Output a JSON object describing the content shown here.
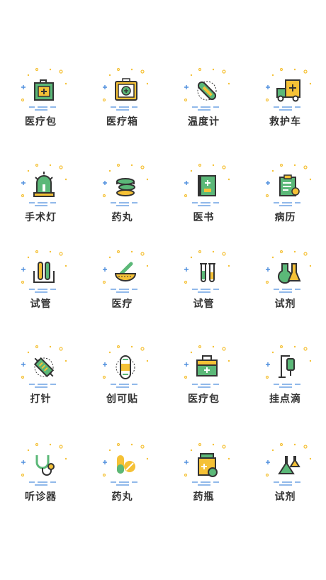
{
  "colors": {
    "green": "#5bb878",
    "dark": "#333333",
    "yellow": "#f5c136",
    "blue": "#4f8fde",
    "bg": "#ffffff"
  },
  "icons": [
    {
      "label": "医疗包",
      "icon": "first-aid-kit-icon"
    },
    {
      "label": "医疗箱",
      "icon": "medical-box-icon"
    },
    {
      "label": "温度计",
      "icon": "thermometer-icon"
    },
    {
      "label": "救护车",
      "icon": "ambulance-icon"
    },
    {
      "label": "手术灯",
      "icon": "surgical-lamp-icon"
    },
    {
      "label": "药丸",
      "icon": "pill-stack-icon"
    },
    {
      "label": "医书",
      "icon": "medical-book-icon"
    },
    {
      "label": "病历",
      "icon": "medical-record-icon"
    },
    {
      "label": "试管",
      "icon": "test-tube-rack-icon"
    },
    {
      "label": "医疗",
      "icon": "mortar-pestle-icon"
    },
    {
      "label": "试管",
      "icon": "test-tubes-icon"
    },
    {
      "label": "试剂",
      "icon": "flasks-icon"
    },
    {
      "label": "打针",
      "icon": "syringe-icon"
    },
    {
      "label": "创可贴",
      "icon": "bandage-icon"
    },
    {
      "label": "医疗包",
      "icon": "medical-bag-icon"
    },
    {
      "label": "挂点滴",
      "icon": "iv-drip-icon"
    },
    {
      "label": "听诊器",
      "icon": "stethoscope-icon"
    },
    {
      "label": "药丸",
      "icon": "capsule-icon"
    },
    {
      "label": "药瓶",
      "icon": "medicine-bottle-icon"
    },
    {
      "label": "试剂",
      "icon": "reagent-flask-icon"
    }
  ]
}
